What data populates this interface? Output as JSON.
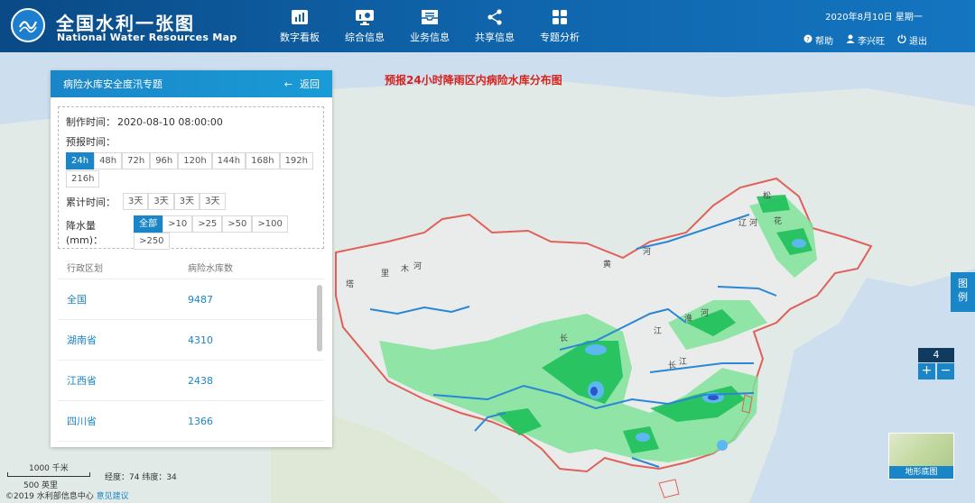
{
  "header": {
    "title_cn": "全国水利一张图",
    "title_en": "National Water Resources Map",
    "nav": [
      {
        "label": "数字看板",
        "icon": "bar-chart-icon"
      },
      {
        "label": "综合信息",
        "icon": "monitor-chart-icon"
      },
      {
        "label": "业务信息",
        "icon": "inbox-icon"
      },
      {
        "label": "共享信息",
        "icon": "share-icon"
      },
      {
        "label": "专题分析",
        "icon": "grid-icon"
      }
    ],
    "date": "2020年8月10日 星期一",
    "help": "帮助",
    "user": "李兴旺",
    "logout": "退出"
  },
  "map": {
    "title": "预报24小时降雨区内病险水库分布图",
    "labels": [
      "塔",
      "里",
      "木",
      "河",
      "黄",
      "河",
      "长",
      "江",
      "淮",
      "河",
      "辽",
      "河",
      "松",
      "花",
      "长",
      "江"
    ]
  },
  "panel": {
    "title": "病险水库安全度汛专题",
    "back": "返回",
    "made_time_label": "制作时间：",
    "made_time": "2020-08-10 08:00:00",
    "forecast_label": "预报时间：",
    "forecast_options": [
      "24h",
      "48h",
      "72h",
      "96h",
      "120h",
      "144h",
      "168h",
      "192h",
      "216h"
    ],
    "forecast_selected": "24h",
    "cumulative_label": "累计时间：",
    "cumulative_options": [
      "3天",
      "3天",
      "3天",
      "3天"
    ],
    "rain_label": "降水量(mm)：",
    "rain_options": [
      "全部",
      ">10",
      ">25",
      ">50",
      ">100",
      ">250"
    ],
    "rain_selected": "全部",
    "table": {
      "headers": [
        "行政区划",
        "病险水库数"
      ],
      "rows": [
        {
          "region": "全国",
          "count": "9487"
        },
        {
          "region": "湖南省",
          "count": "4310"
        },
        {
          "region": "江西省",
          "count": "2438"
        },
        {
          "region": "四川省",
          "count": "1366"
        }
      ]
    }
  },
  "widgets": {
    "legend": "图例",
    "zoom_level": "4",
    "zoom_in": "+",
    "zoom_out": "−",
    "basemap": "地形底图"
  },
  "footer": {
    "scale_km": "1000 千米",
    "scale_mi": "500 英里",
    "coords": "经度：74 纬度：34",
    "copyright": "©2019 水利部信息中心",
    "feedback": "意见建议"
  },
  "colors": {
    "header": "#0f62a8",
    "accent": "#1a86c8",
    "map_title": "#d8221c",
    "rain_light": "#7fe39a",
    "rain_mid": "#1fbf5a",
    "rain_heavy": "#2b7de0"
  }
}
